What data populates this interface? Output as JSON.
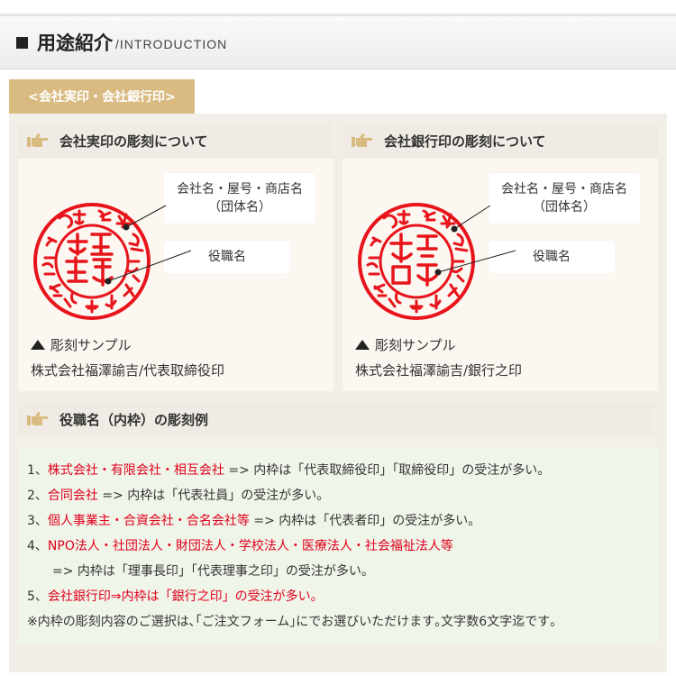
{
  "header": {
    "title_jp": "用途紹介",
    "title_en": "/INTRODUCTION"
  },
  "tab": {
    "label": "<会社実印・会社銀行印>"
  },
  "cards": [
    {
      "title": "会社実印の彫刻について",
      "callout_top_line1": "会社名・屋号・商店名",
      "callout_top_line2": "（団体名）",
      "callout_bottom": "役職名",
      "sample_label": "彫刻サンプル",
      "caption": "株式会社福澤諭吉/代表取締役印"
    },
    {
      "title": "会社銀行印の彫刻について",
      "callout_top_line1": "会社名・屋号・商店名",
      "callout_top_line2": "（団体名）",
      "callout_bottom": "役職名",
      "sample_label": "彫刻サンプル",
      "caption": "株式会社福澤諭吉/銀行之印"
    }
  ],
  "section2": {
    "title": "役職名（内枠）の彫刻例"
  },
  "list": {
    "l1_num": "1、",
    "l1_red": "株式会社・有限会社・相互会社",
    "l1_rest": " => 内枠は「代表取締役印」「取締役印」の受注が多い。",
    "l2_num": "2、",
    "l2_red": "合同会社",
    "l2_rest": " => 内枠は「代表社員」の受注が多い。",
    "l3_num": "3、",
    "l3_red": "個人事業主・合資会社・合名会社等",
    "l3_rest": " => 内枠は「代表者印」の受注が多い。",
    "l4_num": "4、",
    "l4_red": "NPO法人・社団法人・財団法人・学校法人・医療法人・社会福祉法人等",
    "l4b": "=> 内枠は「理事長印」「代表理事之印」の受注が多い。",
    "l5_num": "5、",
    "l5_red": "会社銀行印⇒内枠は「銀行之印」の受注が多い。",
    "note": "※内枠の彫刻内容のご選択は､｢ご注文フォーム｣にでお選びいただけます｡文字数6文字迄です｡"
  },
  "colors": {
    "accent_tab": "#d9bb82",
    "seal_red": "#e8141c",
    "highlight_red": "#e0001b",
    "list_bg": "#f0f5ea"
  },
  "icons": {
    "section_marker": "square-icon",
    "card_heading": "pointing-hand-icon",
    "sample_marker": "triangle-up-icon"
  }
}
